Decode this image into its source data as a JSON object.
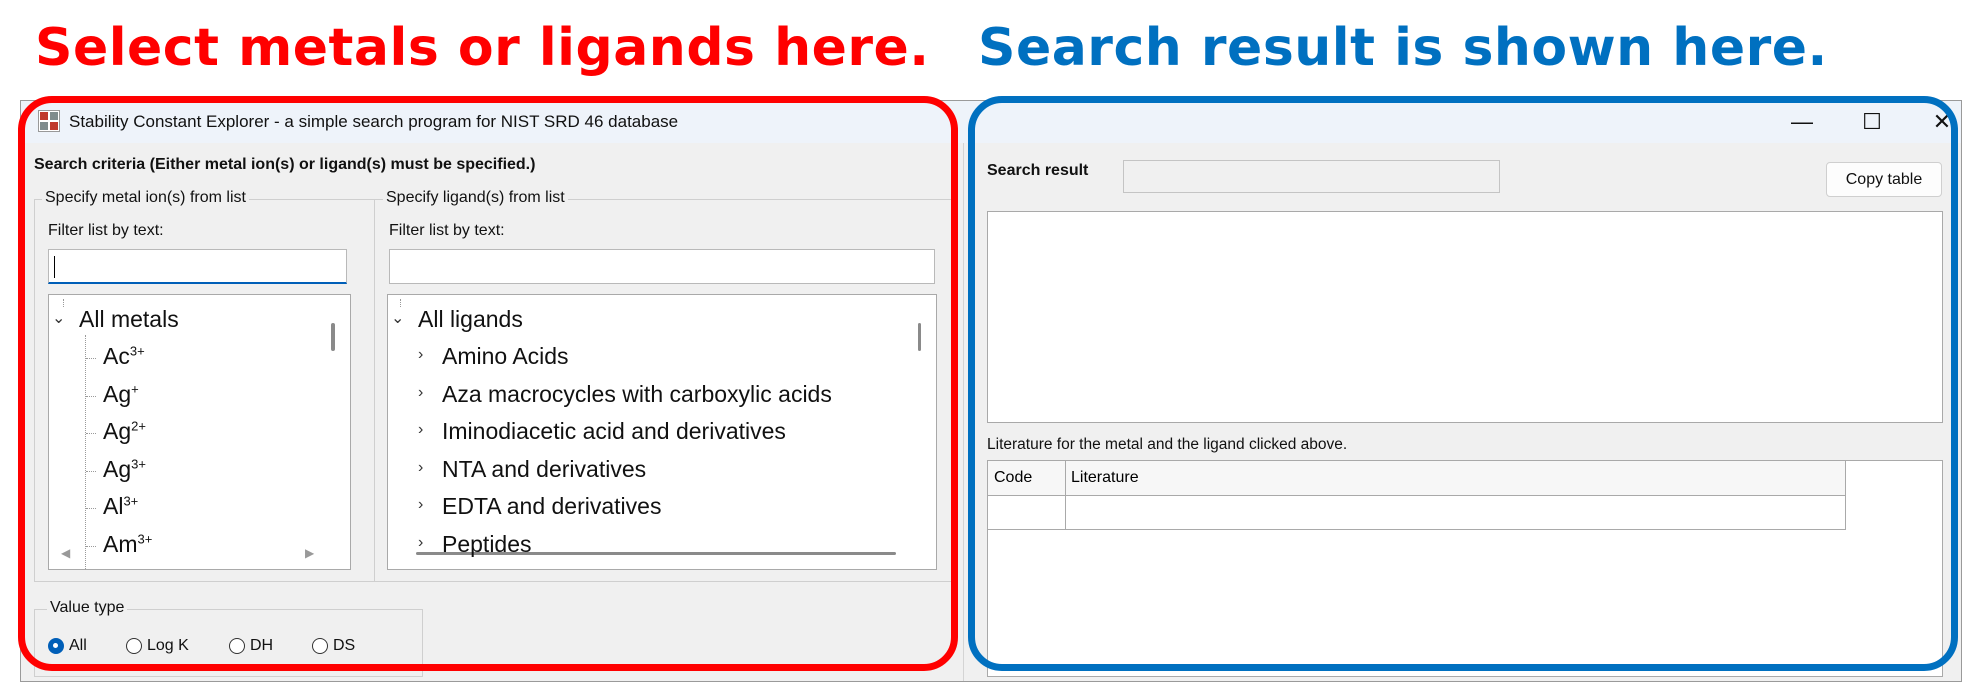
{
  "annotations": {
    "left": "Select metals or ligands here.",
    "right": "Search result is shown here."
  },
  "window": {
    "title": "Stability Constant Explorer - a simple search program for NIST SRD 46 database",
    "icon": "app-icon",
    "controls": {
      "minimize": "—",
      "maximize": "☐",
      "close": "✕"
    }
  },
  "search_panel": {
    "criteria_label": "Search criteria (Either metal ion(s) or ligand(s) must be specified.)",
    "metals": {
      "group_title": "Specify metal ion(s) from list",
      "filter_label": "Filter list by text:",
      "filter_value": "",
      "root": "All metals",
      "items": [
        {
          "base": "Ac",
          "charge": "3+"
        },
        {
          "base": "Ag",
          "charge": "+"
        },
        {
          "base": "Ag",
          "charge": "2+"
        },
        {
          "base": "Ag",
          "charge": "3+"
        },
        {
          "base": "Al",
          "charge": "3+"
        },
        {
          "base": "Am",
          "charge": "3+"
        }
      ]
    },
    "ligands": {
      "group_title": "Specify ligand(s) from list",
      "filter_label": "Filter list by text:",
      "filter_value": "",
      "root": "All ligands",
      "items": [
        "Amino Acids",
        "Aza macrocycles with carboxylic acids",
        "Iminodiacetic acid and derivatives",
        "NTA and derivatives",
        "EDTA and derivatives",
        "Peptides"
      ]
    },
    "value_type": {
      "group_title": "Value type",
      "options": [
        "All",
        "Log K",
        "DH",
        "DS"
      ],
      "selected": "All"
    }
  },
  "results_panel": {
    "search_result_label": "Search result",
    "search_result_value": "",
    "copy_button": "Copy table",
    "literature_label": "Literature for the metal and the ligand clicked above.",
    "literature_columns": [
      "Code",
      "Literature"
    ]
  },
  "colors": {
    "left_outline": "#ff0000",
    "right_outline": "#0070c0",
    "focus_accent": "#005fb8"
  }
}
